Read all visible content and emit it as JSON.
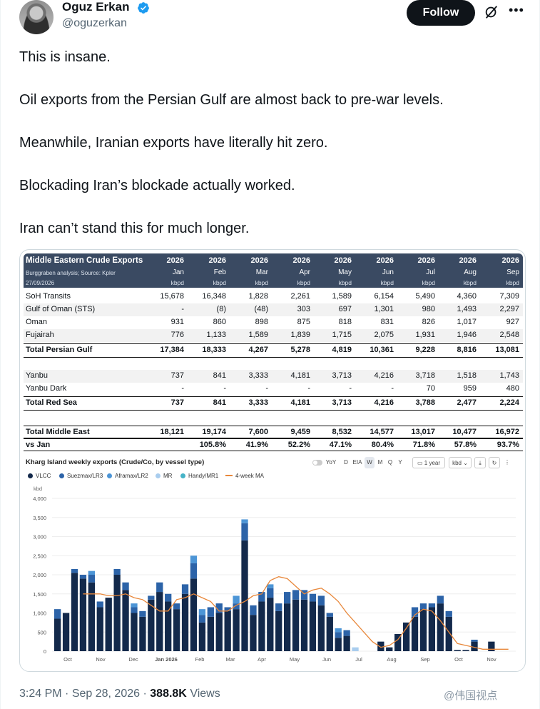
{
  "author": {
    "name": "Oguz Erkan",
    "handle": "@oguzerkan",
    "follow_label": "Follow"
  },
  "tweet": {
    "lines": [
      "This is insane.",
      "Oil exports from the Persian Gulf are almost back to pre-war levels.",
      "Meanwhile, Iranian exports have literally hit zero.",
      "Blockading Iran’s blockade actually worked.",
      "Iran can’t stand this for much longer."
    ]
  },
  "table": {
    "title": "Middle Eastern Crude Exports",
    "source": "Burggraben analysis; Source: Kpler",
    "date": "27/09/2026",
    "years": [
      "2026",
      "2026",
      "2026",
      "2026",
      "2026",
      "2026",
      "2026",
      "2026",
      "2026"
    ],
    "months": [
      "Jan",
      "Feb",
      "Mar",
      "Apr",
      "May",
      "Jun",
      "Jul",
      "Aug",
      "Sep"
    ],
    "units": [
      "kbpd",
      "kbpd",
      "kbpd",
      "kbpd",
      "kbpd",
      "kbpd",
      "kbpd",
      "kbpd",
      "kbpd"
    ],
    "rows": [
      {
        "label": "SoH Transits",
        "values": [
          "15,678",
          "16,348",
          "1,828",
          "2,261",
          "1,589",
          "6,154",
          "5,490",
          "4,360",
          "7,309"
        ]
      },
      {
        "label": "Gulf of Oman (STS)",
        "values": [
          "-",
          "(8)",
          "(48)",
          "303",
          "697",
          "1,301",
          "980",
          "1,493",
          "2,297"
        ]
      },
      {
        "label": "Oman",
        "values": [
          "931",
          "860",
          "898",
          "875",
          "818",
          "831",
          "826",
          "1,017",
          "927"
        ]
      },
      {
        "label": "Fujairah",
        "values": [
          "776",
          "1,133",
          "1,589",
          "1,839",
          "1,715",
          "2,075",
          "1,931",
          "1,946",
          "2,548"
        ]
      },
      {
        "label": "Total Persian Gulf",
        "values": [
          "17,384",
          "18,333",
          "4,267",
          "5,278",
          "4,819",
          "10,361",
          "9,228",
          "8,816",
          "13,081"
        ]
      },
      {
        "label": "Yanbu",
        "values": [
          "737",
          "841",
          "3,333",
          "4,181",
          "3,713",
          "4,216",
          "3,718",
          "1,518",
          "1,743"
        ]
      },
      {
        "label": "Yanbu Dark",
        "values": [
          "-",
          "-",
          "-",
          "-",
          "-",
          "-",
          "70",
          "959",
          "480"
        ]
      },
      {
        "label": "Total Red Sea",
        "values": [
          "737",
          "841",
          "3,333",
          "4,181",
          "3,713",
          "4,216",
          "3,788",
          "2,477",
          "2,224"
        ]
      },
      {
        "label": "Total Middle East",
        "values": [
          "18,121",
          "19,174",
          "7,600",
          "9,459",
          "8,532",
          "14,577",
          "13,017",
          "10,477",
          "16,972"
        ]
      },
      {
        "label": "vs Jan",
        "values": [
          "",
          "105.8%",
          "41.9%",
          "52.2%",
          "47.1%",
          "80.4%",
          "71.8%",
          "57.8%",
          "93.7%"
        ]
      }
    ]
  },
  "chart": {
    "title": "Kharg Island weekly exports (Crude/Co, by vessel type)",
    "unit": "kbd",
    "controls": [
      "YoY",
      "D",
      "EIA",
      "W",
      "M",
      "Q",
      "Y",
      "1 year",
      "kbd"
    ],
    "legend": [
      "VLCC",
      "Suezmax/LR3",
      "Aframax/LR2",
      "MR",
      "Handy/MR1",
      "4-week MA"
    ],
    "colors": {
      "VLCC": "#13294b",
      "Suezmax/LR3": "#2c63a8",
      "Aframax/LR2": "#4c95d6",
      "MR": "#a9cdee",
      "Handy/MR1": "#45b3c7",
      "4-week MA": "#e8873a"
    }
  },
  "chart_data": {
    "type": "bar",
    "title": "Kharg Island weekly exports (Crude/Co, by vessel type)",
    "ylabel": "kbd",
    "ylim": [
      0,
      4000
    ],
    "yticks": [
      0,
      500,
      1000,
      1500,
      2000,
      2500,
      3000,
      3500,
      4000
    ],
    "xticks": [
      "Oct",
      "Nov",
      "Dec",
      "Jan 2026",
      "Feb",
      "Mar",
      "Apr",
      "May",
      "Jun",
      "Jul",
      "Aug",
      "Sep",
      "Oct",
      "Nov"
    ],
    "series": [
      {
        "name": "VLCC",
        "values": [
          850,
          1000,
          2050,
          1900,
          1800,
          1150,
          1400,
          2000,
          1600,
          1000,
          900,
          1350,
          1550,
          1300,
          1100,
          1500,
          1900,
          750,
          900,
          1000,
          1050,
          1100,
          2900,
          950,
          1300,
          1400,
          1050,
          1250,
          1350,
          1350,
          1300,
          1200,
          900,
          350,
          400,
          0,
          0,
          0,
          250,
          100,
          450,
          750,
          900,
          1100,
          1150,
          1250,
          900,
          30,
          30,
          250,
          0,
          250,
          0,
          0
        ]
      },
      {
        "name": "Suezmax/LR3",
        "values": [
          250,
          0,
          100,
          100,
          200,
          150,
          0,
          150,
          200,
          150,
          150,
          100,
          250,
          200,
          150,
          250,
          400,
          200,
          250,
          250,
          100,
          150,
          450,
          250,
          250,
          250,
          200,
          300,
          250,
          250,
          200,
          250,
          100,
          150,
          150,
          0,
          0,
          0,
          0,
          0,
          0,
          0,
          250,
          150,
          100,
          200,
          150,
          0,
          0,
          50,
          0,
          0,
          0,
          0
        ]
      },
      {
        "name": "Aframax/LR2",
        "values": [
          0,
          0,
          0,
          0,
          100,
          0,
          0,
          0,
          0,
          100,
          0,
          0,
          0,
          0,
          0,
          0,
          200,
          150,
          0,
          0,
          0,
          200,
          100,
          0,
          0,
          100,
          0,
          0,
          0,
          0,
          0,
          0,
          0,
          100,
          0,
          0,
          0,
          0,
          0,
          0,
          0,
          0,
          0,
          0,
          0,
          0,
          0,
          0,
          0,
          0,
          0,
          0,
          0,
          0
        ]
      },
      {
        "name": "MR",
        "values": [
          0,
          0,
          0,
          0,
          0,
          0,
          0,
          0,
          0,
          0,
          0,
          0,
          0,
          0,
          0,
          0,
          0,
          0,
          0,
          0,
          0,
          0,
          0,
          0,
          0,
          0,
          0,
          0,
          0,
          0,
          0,
          0,
          0,
          0,
          0,
          100,
          0,
          0,
          0,
          0,
          0,
          0,
          0,
          0,
          0,
          0,
          0,
          0,
          0,
          0,
          0,
          0,
          0,
          0
        ]
      },
      {
        "name": "Handy/MR1",
        "values": [
          0,
          0,
          0,
          0,
          0,
          0,
          0,
          0,
          0,
          0,
          0,
          0,
          0,
          0,
          0,
          0,
          0,
          0,
          0,
          0,
          0,
          0,
          0,
          0,
          0,
          0,
          0,
          0,
          0,
          0,
          0,
          0,
          0,
          0,
          0,
          0,
          0,
          0,
          0,
          0,
          0,
          0,
          0,
          0,
          0,
          0,
          0,
          0,
          0,
          0,
          0,
          0,
          0,
          0
        ]
      }
    ],
    "ma": [
      null,
      null,
      null,
      1500,
      1500,
      1500,
      1450,
      1450,
      1500,
      1400,
      1350,
      1200,
      1050,
      1050,
      1350,
      1400,
      1500,
      1400,
      1300,
      1050,
      1050,
      1200,
      1300,
      1450,
      1500,
      1850,
      1950,
      1900,
      1700,
      1500,
      1600,
      1650,
      1500,
      1300,
      1000,
      750,
      500,
      250,
      100,
      150,
      300,
      600,
      950,
      1100,
      1050,
      800,
      500,
      200,
      150,
      100,
      50,
      50,
      50,
      50
    ]
  }
}
